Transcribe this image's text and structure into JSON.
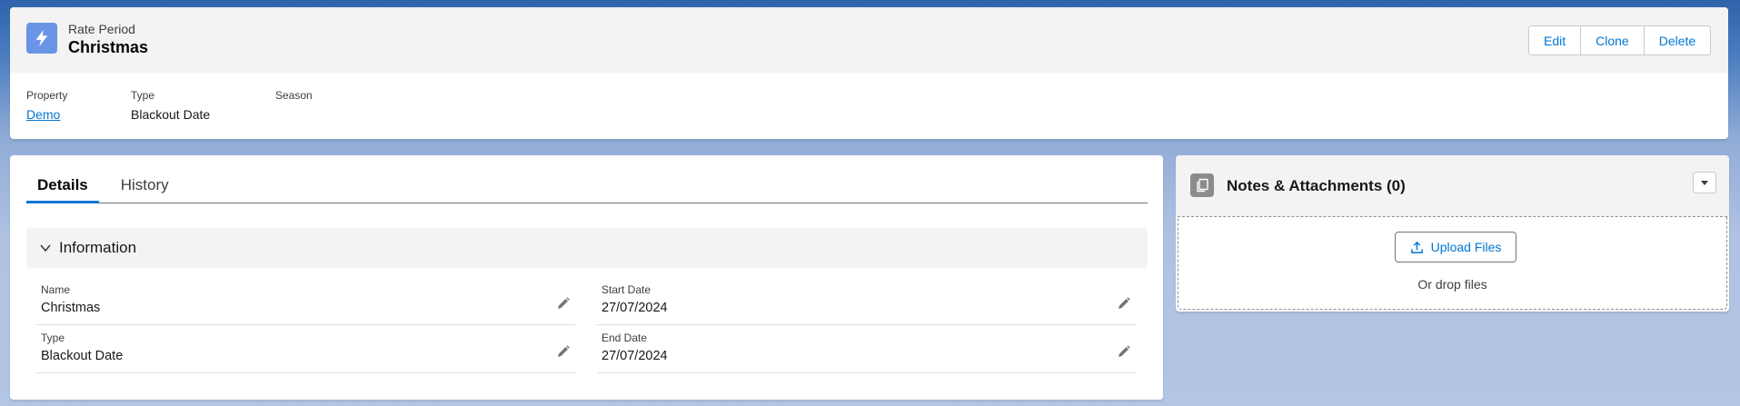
{
  "header": {
    "object_label": "Rate Period",
    "record_title": "Christmas",
    "icon": "lightning-bolt-icon",
    "icon_color": "#6a94e5",
    "buttons": {
      "edit": "Edit",
      "clone": "Clone",
      "delete": "Delete"
    }
  },
  "highlights": [
    {
      "label": "Property",
      "value": "Demo",
      "is_link": true
    },
    {
      "label": "Type",
      "value": "Blackout Date",
      "is_link": false
    },
    {
      "label": "Season",
      "value": "",
      "is_link": false
    }
  ],
  "details": {
    "tabs": [
      {
        "label": "Details",
        "active": true
      },
      {
        "label": "History",
        "active": false
      }
    ],
    "section_title": "Information",
    "fields": [
      {
        "label": "Name",
        "value": "Christmas"
      },
      {
        "label": "Start Date",
        "value": "27/07/2024"
      },
      {
        "label": "Type",
        "value": "Blackout Date"
      },
      {
        "label": "End Date",
        "value": "27/07/2024"
      }
    ]
  },
  "notes": {
    "title": "Notes & Attachments (0)",
    "upload_label": "Upload Files",
    "drop_text": "Or drop files"
  },
  "colors": {
    "brand_blue": "#0176d3",
    "header_bg": "#f3f3f3"
  }
}
